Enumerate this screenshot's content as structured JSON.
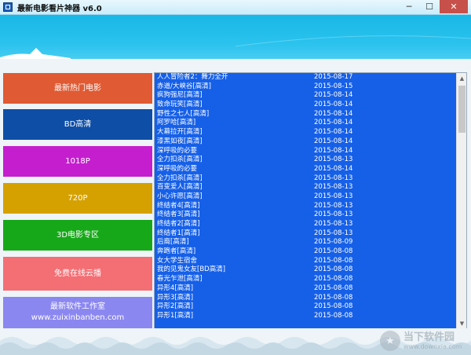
{
  "window": {
    "title": "最新电影看片神器 v6.0",
    "controls": {
      "minimize": "─",
      "maximize": "☐",
      "close": "✕"
    }
  },
  "sidebar": {
    "items": [
      {
        "label": "最新热门电影",
        "color": "#e05a33"
      },
      {
        "label": "BD高清",
        "color": "#0e4ea6"
      },
      {
        "label": "1018P",
        "color": "#c51ecf"
      },
      {
        "label": "720P",
        "color": "#d5a100"
      },
      {
        "label": "3D电影专区",
        "color": "#17a81a"
      },
      {
        "label": "免费在线云播",
        "color": "#f36f74"
      },
      {
        "label": "最新软件工作室",
        "label2": "www.zuixinbanben.com",
        "color": "#8b87f0"
      }
    ]
  },
  "movie_list": {
    "background": "#1660e8",
    "rows": [
      {
        "title": "人人冒险者2：舞力全开",
        "date": "2015-08-17"
      },
      {
        "title": "赤道/大峡谷[高清]",
        "date": "2015-08-15"
      },
      {
        "title": "疯狗强尼[高清]",
        "date": "2015-08-14"
      },
      {
        "title": "致命玩笑[高清]",
        "date": "2015-08-14"
      },
      {
        "title": "野性之七人[高清]",
        "date": "2015-08-14"
      },
      {
        "title": "阿罗哈[高清]",
        "date": "2015-08-14"
      },
      {
        "title": "大幕拉开[高清]",
        "date": "2015-08-14"
      },
      {
        "title": "漆黑如夜[高清]",
        "date": "2015-08-14"
      },
      {
        "title": "深呼吸的必要",
        "date": "2015-08-14"
      },
      {
        "title": "全力扣杀[高清]",
        "date": "2015-08-13"
      },
      {
        "title": "深呼吸的必要",
        "date": "2015-08-14"
      },
      {
        "title": "全力扣杀[高清]",
        "date": "2015-08-13"
      },
      {
        "title": "百变爱人[高清]",
        "date": "2015-08-13"
      },
      {
        "title": "小心许愿[高清]",
        "date": "2015-08-13"
      },
      {
        "title": "终结者4[高清]",
        "date": "2015-08-13"
      },
      {
        "title": "终结者3[高清]",
        "date": "2015-08-13"
      },
      {
        "title": "终结者2[高清]",
        "date": "2015-08-13"
      },
      {
        "title": "终结者1[高清]",
        "date": "2015-08-13"
      },
      {
        "title": "后裔[高清]",
        "date": "2015-08-09"
      },
      {
        "title": "奔跑者[高清]",
        "date": "2015-08-08"
      },
      {
        "title": "女大学生宿舍",
        "date": "2015-08-08"
      },
      {
        "title": "我的见鬼女友[BD高清]",
        "date": "2015-08-08"
      },
      {
        "title": "春光乍泄[高清]",
        "date": "2015-08-08"
      },
      {
        "title": "异形4[高清]",
        "date": "2015-08-08"
      },
      {
        "title": "异形3[高清]",
        "date": "2015-08-08"
      },
      {
        "title": "异形2[高清]",
        "date": "2015-08-08"
      },
      {
        "title": "异形1[高清]",
        "date": "2015-08-08"
      }
    ]
  },
  "scrollbar": {
    "up_arrow": "▲",
    "down_arrow": "▼"
  },
  "watermark": {
    "logo_glyph": "★",
    "title": "当下软件园",
    "url": "www.downxia.com"
  }
}
